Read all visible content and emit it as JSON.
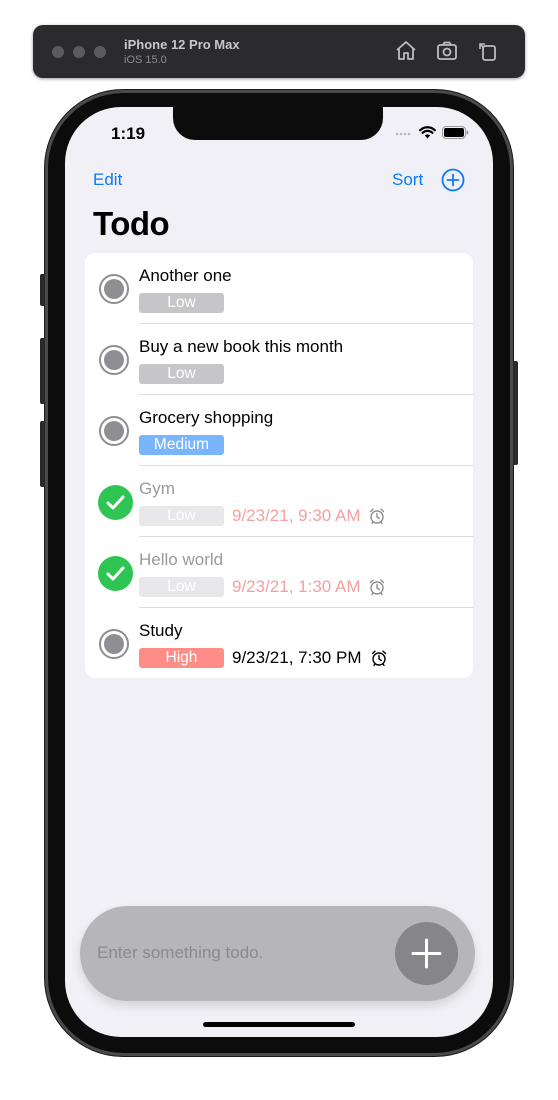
{
  "simulator": {
    "device": "iPhone 12 Pro Max",
    "os": "iOS 15.0",
    "icons": [
      "home-icon",
      "screenshot-icon",
      "rotate-icon"
    ]
  },
  "status_bar": {
    "time": "1:19"
  },
  "nav": {
    "edit_label": "Edit",
    "sort_label": "Sort",
    "add_icon": "plus-circle-icon"
  },
  "title": "Todo",
  "todos": [
    {
      "title": "Another one",
      "priority": "Low",
      "done": false,
      "date": ""
    },
    {
      "title": "Buy a new book this month",
      "priority": "Low",
      "done": false,
      "date": ""
    },
    {
      "title": "Grocery shopping",
      "priority": "Medium",
      "done": false,
      "date": ""
    },
    {
      "title": "Gym",
      "priority": "Low",
      "done": true,
      "date": "9/23/21, 9:30 AM"
    },
    {
      "title": "Hello world",
      "priority": "Low",
      "done": true,
      "date": "9/23/21, 1:30 AM"
    },
    {
      "title": "Study",
      "priority": "High",
      "done": false,
      "date": "9/23/21, 7:30 PM"
    }
  ],
  "priority_colors": {
    "Low": "#c6c6c8",
    "Low_done": "#e8e8ea",
    "Medium": "#78b5fa",
    "High": "#fd8d86"
  },
  "input": {
    "placeholder": "Enter something todo.",
    "add_icon": "plus-icon"
  },
  "colors": {
    "accent": "#0a7aff",
    "check": "#2fc552",
    "overdue_date": "#f2a19f"
  }
}
